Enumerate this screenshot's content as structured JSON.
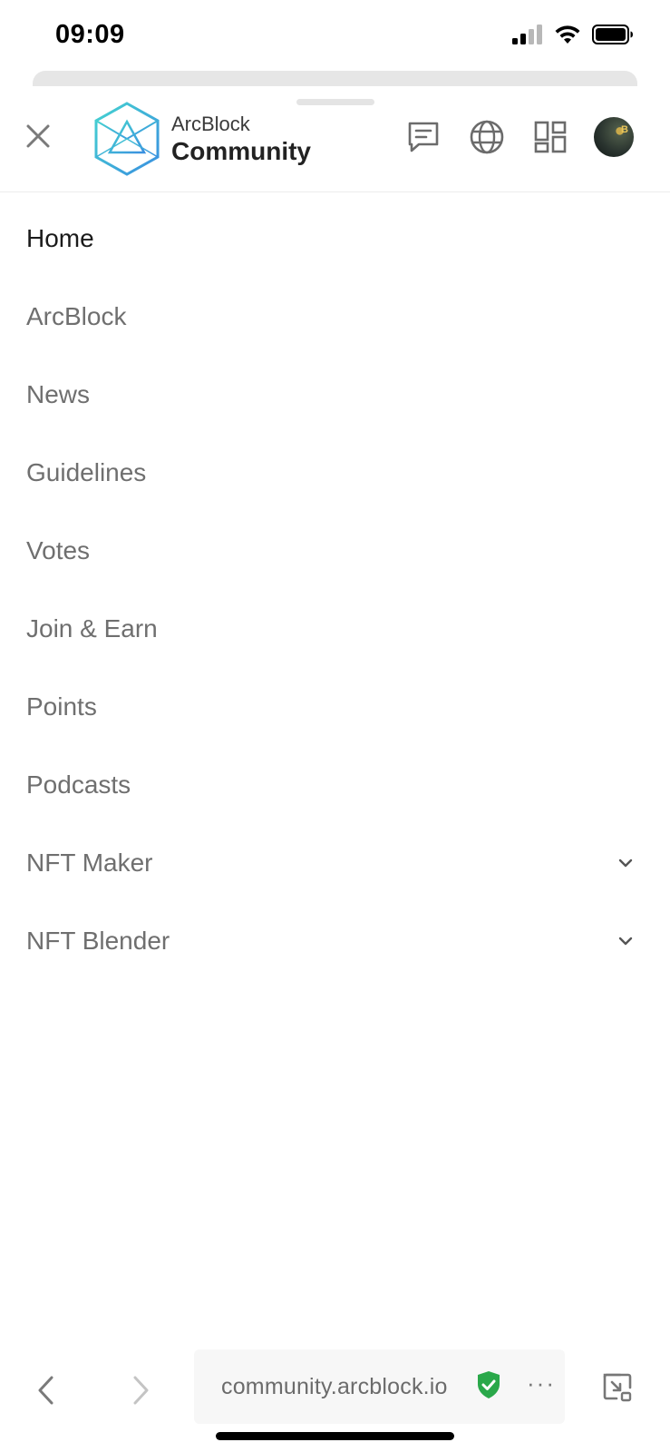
{
  "status_bar": {
    "time": "09:09",
    "icons": [
      "cellular-signal-icon",
      "wifi-icon",
      "battery-icon"
    ]
  },
  "header": {
    "close_icon": "close-icon",
    "logo": {
      "top_text": "ArcBlock",
      "bottom_text": "Community",
      "icon": "arcblock-logo-icon",
      "accent": "#3ec6e0"
    },
    "actions": [
      "chat-icon",
      "globe-icon",
      "apps-grid-icon",
      "user-avatar"
    ]
  },
  "menu": {
    "items": [
      {
        "label": "Home",
        "active": true,
        "expandable": false
      },
      {
        "label": "ArcBlock",
        "active": false,
        "expandable": false
      },
      {
        "label": "News",
        "active": false,
        "expandable": false
      },
      {
        "label": "Guidelines",
        "active": false,
        "expandable": false
      },
      {
        "label": "Votes",
        "active": false,
        "expandable": false
      },
      {
        "label": "Join & Earn",
        "active": false,
        "expandable": false
      },
      {
        "label": "Points",
        "active": false,
        "expandable": false
      },
      {
        "label": "Podcasts",
        "active": false,
        "expandable": false
      },
      {
        "label": "NFT Maker",
        "active": false,
        "expandable": true
      },
      {
        "label": "NFT Blender",
        "active": false,
        "expandable": true
      }
    ]
  },
  "browser": {
    "url": "community.arcblock.io",
    "secure_color": "#2aa84a",
    "more_label": "···"
  }
}
